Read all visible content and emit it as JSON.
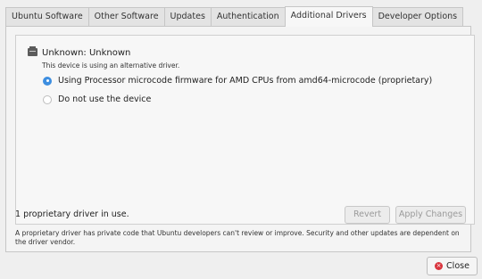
{
  "tabs": [
    {
      "label": "Ubuntu Software"
    },
    {
      "label": "Other Software"
    },
    {
      "label": "Updates"
    },
    {
      "label": "Authentication"
    },
    {
      "label": "Additional Drivers"
    },
    {
      "label": "Developer Options"
    }
  ],
  "device": {
    "title": "Unknown: Unknown",
    "status": "This device is using an alternative driver.",
    "options": [
      {
        "label": "Using Processor microcode firmware for AMD CPUs from amd64-microcode (proprietary)",
        "selected": true
      },
      {
        "label": "Do not use the device",
        "selected": false
      }
    ]
  },
  "footer": {
    "status": "1 proprietary driver in use.",
    "revert_label": "Revert",
    "apply_label": "Apply Changes",
    "description": "A proprietary driver has private code that Ubuntu developers can't review or improve. Security and other updates are dependent on the driver vendor."
  },
  "close_label": "Close",
  "colors": {
    "accent": "#3d8ee0",
    "close_icon": "#d9343d"
  },
  "icons": [
    "device-icon",
    "radio-checked-icon",
    "radio-unchecked-icon",
    "close-icon"
  ]
}
